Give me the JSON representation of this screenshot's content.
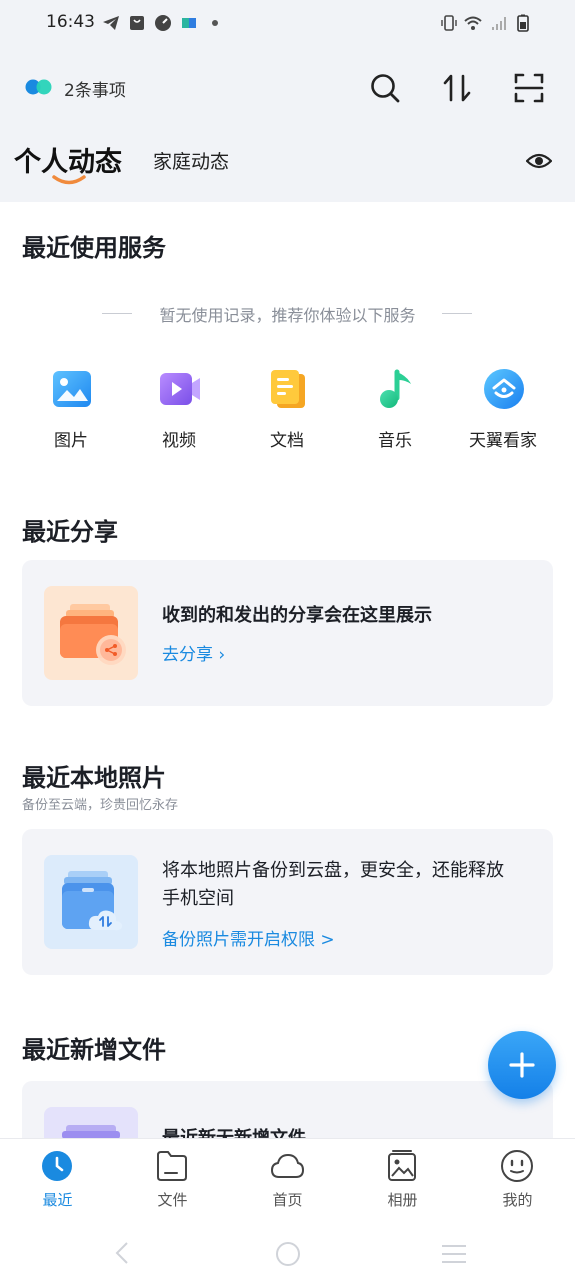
{
  "status_bar": {
    "time": "16:43"
  },
  "header": {
    "todo_label": "2条事项"
  },
  "tabs": {
    "active": "个人动态",
    "inactive": "家庭动态"
  },
  "recent_services": {
    "title": "最近使用服务",
    "empty_hint": "暂无使用记录，推荐你体验以下服务",
    "items": [
      {
        "label": "图片",
        "icon": "image-icon"
      },
      {
        "label": "视频",
        "icon": "video-icon"
      },
      {
        "label": "文档",
        "icon": "document-icon"
      },
      {
        "label": "音乐",
        "icon": "music-icon"
      },
      {
        "label": "天翼看家",
        "icon": "home-camera-icon"
      }
    ]
  },
  "recent_share": {
    "title": "最近分享",
    "text": "收到的和发出的分享会在这里展示",
    "link": "去分享 ›"
  },
  "local_photos": {
    "title": "最近本地照片",
    "subtitle": "备份至云端，珍贵回忆永存",
    "text_line1": "将本地照片备份到云盘，更安全，还能释放",
    "text_line2": "手机空间",
    "link": "备份照片需开启权限 >"
  },
  "recent_files": {
    "title": "最近新增文件",
    "text": "最近新无新增文件"
  },
  "bottom_nav": [
    {
      "label": "最近",
      "icon": "clock-icon",
      "active": true
    },
    {
      "label": "文件",
      "icon": "folder-icon",
      "active": false
    },
    {
      "label": "首页",
      "icon": "cloud-icon",
      "active": false
    },
    {
      "label": "相册",
      "icon": "album-icon",
      "active": false
    },
    {
      "label": "我的",
      "icon": "face-icon",
      "active": false
    }
  ],
  "colors": {
    "accent": "#1a8ae0",
    "fab": "#1c8cf0",
    "tab_underline": "#f08a3c"
  }
}
